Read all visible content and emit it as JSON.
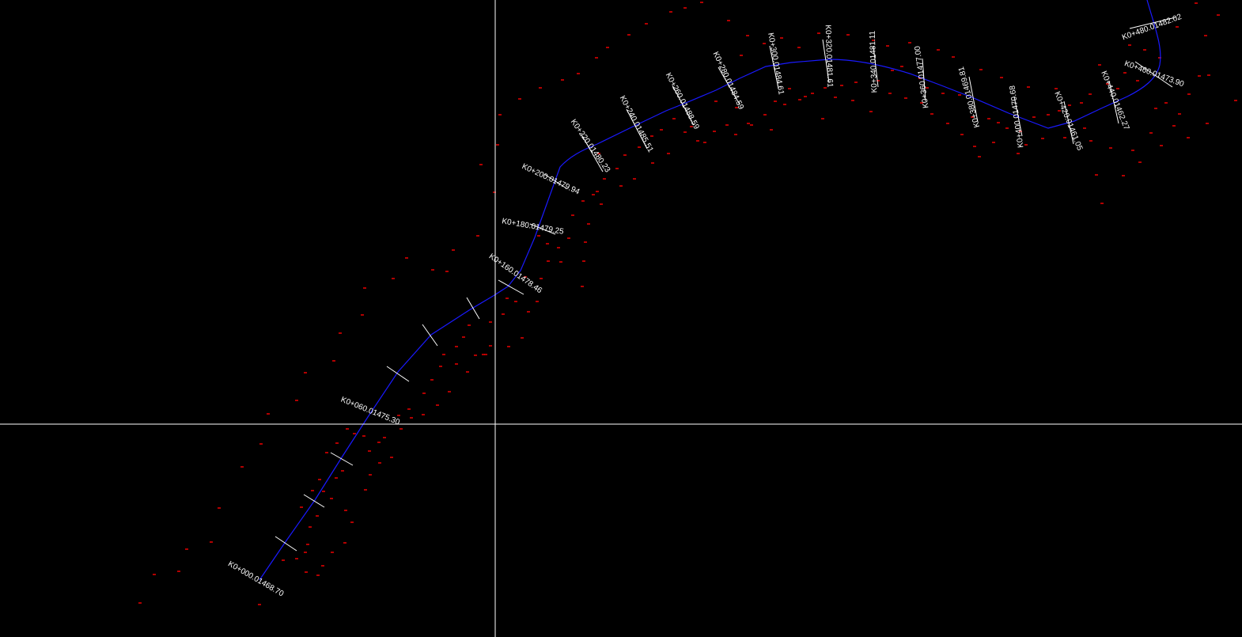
{
  "stations": [
    {
      "label": "K0+000.01468.70"
    },
    {
      "label": "K0+060.01475.30"
    },
    {
      "label": "K0+160.01478.46"
    },
    {
      "label": "K0+180.01479.25"
    },
    {
      "label": "K0+200.01479.94"
    },
    {
      "label": "K0+220.01480.23"
    },
    {
      "label": "K0+240.01485.51"
    },
    {
      "label": "K0+260.01488.59"
    },
    {
      "label": "K0+280.01484.59"
    },
    {
      "label": "K0+300.01484.61"
    },
    {
      "label": "K0+320.01481.61"
    },
    {
      "label": "K0+340.01481.11"
    },
    {
      "label": "K0+360.01477.00"
    },
    {
      "label": "K0+380.01469.81"
    },
    {
      "label": "K0+400.01470.68"
    },
    {
      "label": "K0+420.01461.05"
    },
    {
      "label": "K0+440.01462.27"
    },
    {
      "label": "K0+460.01473.90"
    },
    {
      "label": "K0+480.01482.02"
    }
  ],
  "colors": {
    "background": "#000000",
    "alignment": "#1a1aff",
    "points": "#ff0000",
    "text": "#ffffff",
    "crosshair": "#ffffff"
  }
}
